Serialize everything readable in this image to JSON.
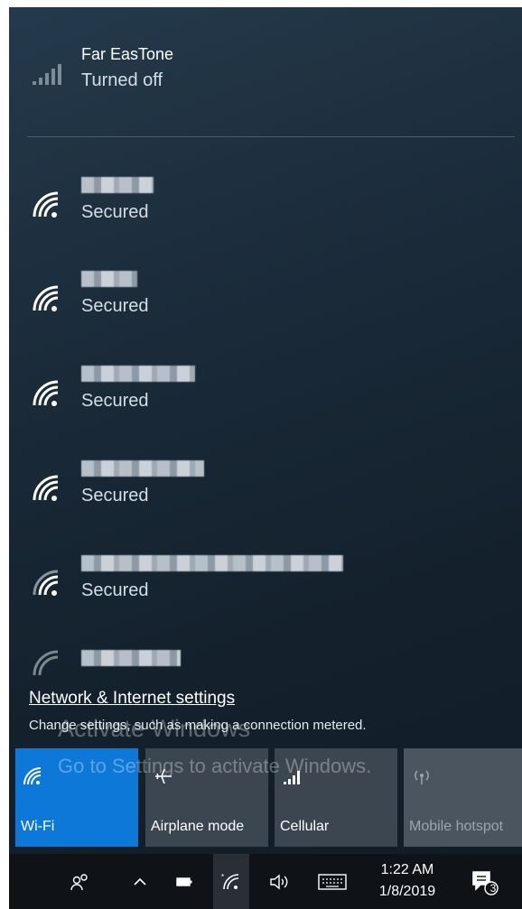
{
  "cellular_network": {
    "name": "Far EasTone",
    "status": "Turned off"
  },
  "wifi_networks": [
    {
      "status": "Secured"
    },
    {
      "status": "Secured"
    },
    {
      "status": "Secured"
    },
    {
      "status": "Secured"
    },
    {
      "status": "Secured"
    },
    {
      "status": ""
    }
  ],
  "settings": {
    "link": "Network & Internet settings",
    "description": "Change settings, such as making a connection metered."
  },
  "quick_actions": [
    {
      "label": "Wi-Fi",
      "icon": "wifi-icon",
      "active": true
    },
    {
      "label": "Airplane mode",
      "icon": "airplane-icon",
      "active": false
    },
    {
      "label": "Cellular",
      "icon": "cellular-icon",
      "active": false
    },
    {
      "label": "Mobile hotspot",
      "icon": "hotspot-icon",
      "active": false,
      "disabled": true
    }
  ],
  "watermark": {
    "line1": "Activate Windows",
    "line2": "Go to Settings to activate Windows."
  },
  "taskbar": {
    "time": "1:22 AM",
    "date": "1/8/2019",
    "notification_count": "3"
  },
  "colors": {
    "accent": "#0d78d7",
    "panel": "#1b2b3a",
    "tile": "#3c4650",
    "taskbar": "#0f1216"
  }
}
